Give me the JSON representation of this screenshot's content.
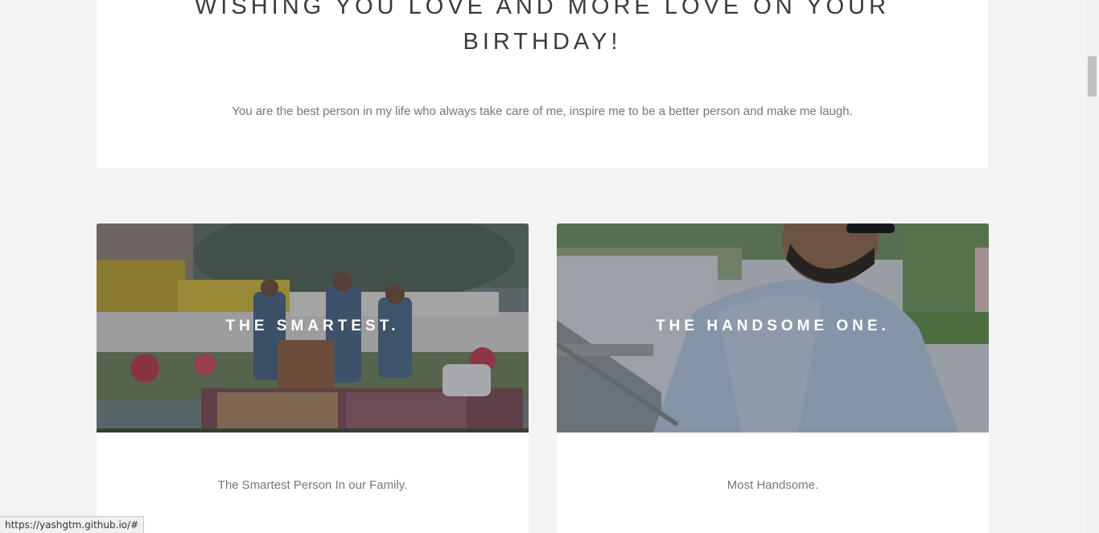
{
  "hero": {
    "title": "WISHING YOU LOVE AND MORE LOVE ON YOUR BIRTHDAY!",
    "text": "You are the best person in my life who always take care of me, inspire me to be a better person and make me laugh."
  },
  "cards": [
    {
      "title": "THE SMARTEST.",
      "text": "The Smartest Person In our Family.",
      "image_icon": "photo-kids-at-school-exhibit"
    },
    {
      "title": "THE HANDSOME ONE.",
      "text": "Most Handsome.",
      "image_icon": "photo-man-with-beard"
    }
  ],
  "status_bar": {
    "url": "https://yashgtm.github.io/#"
  },
  "colors": {
    "background": "#f3f3f3",
    "card": "#ffffff",
    "title_text": "#3a3a3a",
    "body_text": "#777777"
  }
}
